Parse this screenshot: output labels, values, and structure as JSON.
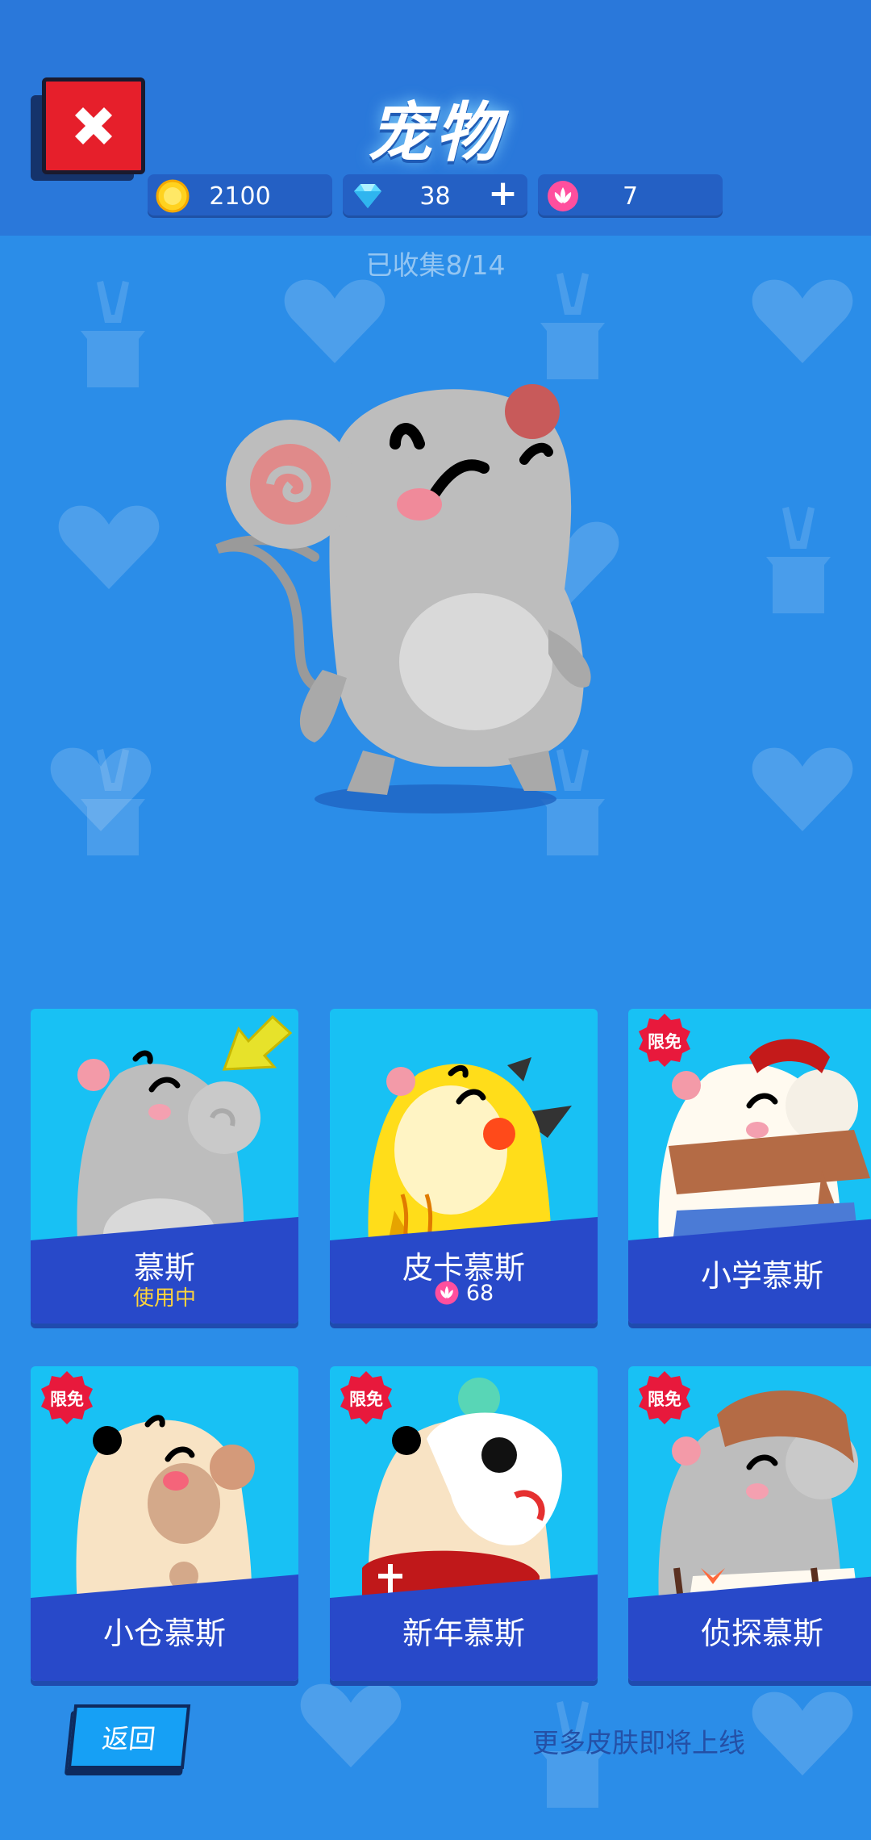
{
  "header": {
    "title": "宠物",
    "close_icon": "close-x-icon",
    "currencies": [
      {
        "name": "coin",
        "icon": "gold-coin-icon",
        "value": "2100",
        "color": "#ffd21f"
      },
      {
        "name": "diamond",
        "icon": "diamond-icon",
        "value": "38",
        "plus": "+",
        "color": "#5ed8ff"
      },
      {
        "name": "lotus",
        "icon": "lotus-icon",
        "value": "7",
        "color": "#ff4f9e"
      }
    ]
  },
  "collection": {
    "text": "已收集8/14"
  },
  "cards": [
    {
      "name": "慕斯",
      "status": "使用中",
      "selected": true
    },
    {
      "name": "皮卡慕斯",
      "price": "68",
      "price_icon": "lotus-icon"
    },
    {
      "name": "小学慕斯",
      "badge": "限免"
    },
    {
      "name": "小仓慕斯",
      "badge": "限免"
    },
    {
      "name": "新年慕斯",
      "badge": "限免"
    },
    {
      "name": "侦探慕斯",
      "badge": "限免"
    }
  ],
  "footer": {
    "back_label": "返回",
    "more_text": "更多皮肤即将上线"
  },
  "colors": {
    "background": "#2b8de8",
    "header": "#2a78da",
    "card": "#18c1f4",
    "card_banner": "#2849c9",
    "close_button": "#e61f2b",
    "status_text": "#ffd43b",
    "badge": "#e8193c"
  }
}
